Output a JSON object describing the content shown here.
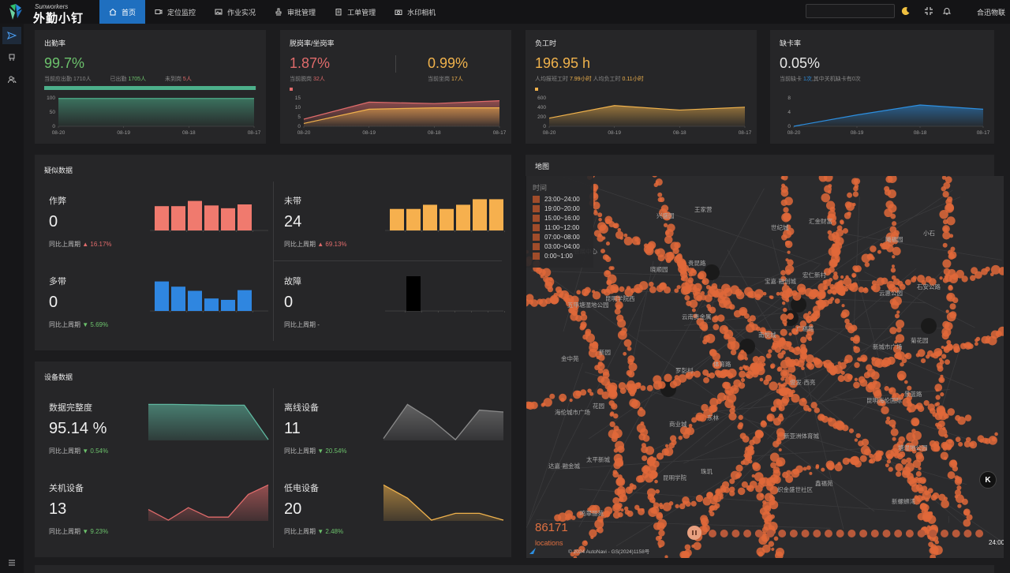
{
  "brand": {
    "sub": "Sunworkers",
    "name": "外勤小钉"
  },
  "nav": [
    {
      "label": "首页",
      "icon": "home-icon",
      "active": true
    },
    {
      "label": "定位监控",
      "icon": "video-icon",
      "active": false
    },
    {
      "label": "作业实况",
      "icon": "image-icon",
      "active": false
    },
    {
      "label": "审批管理",
      "icon": "stamp-icon",
      "active": false
    },
    {
      "label": "工单管理",
      "icon": "clipboard-icon",
      "active": false
    },
    {
      "label": "水印相机",
      "icon": "camera-icon",
      "active": false
    }
  ],
  "header": {
    "search_value": "",
    "org": "合迅物联"
  },
  "kpi": {
    "attendance": {
      "title": "出勤率",
      "value": "99.7%",
      "s1_label": "当前应出勤",
      "s1_value": "1710人",
      "s2_label": "已出勤",
      "s2_value": "1705人",
      "s3_label": "未到岗",
      "s3_value": "5人",
      "progress": 0.997
    },
    "offpost": {
      "title": "脱岗率/坐岗率",
      "value": "1.87%",
      "value2": "0.99%",
      "s1_label": "当前脱岗",
      "s1_value": "32人",
      "s2_label": "当前坐岗",
      "s2_value": "17人"
    },
    "workhours": {
      "title": "负工时",
      "value": "196.95 h",
      "s1_label": "人均报班工时",
      "s1_value": "7.99小时",
      "s2_label": "人均负工时",
      "s2_value": "0.11小时"
    },
    "cardmiss": {
      "title": "缺卡率",
      "value": "0.05%",
      "s1_label": "当前缺卡",
      "s1_value": "1次",
      "s2_label": ",其中关机缺卡有",
      "s2_value": "0次"
    }
  },
  "mini_charts": {
    "dates": [
      "08-20",
      "08-19",
      "08-18",
      "08-17"
    ],
    "attendance": {
      "ticks": [
        "100",
        "50",
        "0"
      ],
      "ymax": 100,
      "values": [
        98,
        98,
        98,
        98
      ],
      "color": "#4caf8a"
    },
    "offpost": {
      "ticks": [
        "15",
        "10",
        "5",
        "0"
      ],
      "ymax": 20,
      "series": [
        {
          "values": [
            5,
            17,
            16,
            18
          ],
          "color": "#e06b6b"
        },
        {
          "values": [
            2,
            12,
            13,
            13
          ],
          "color": "#f0b24c"
        }
      ]
    },
    "workhours": {
      "ticks": [
        "600",
        "400",
        "200",
        "0"
      ],
      "ymax": 700,
      "values": [
        200,
        510,
        400,
        470
      ],
      "color": "#f0b24c"
    },
    "cardmiss": {
      "ticks": [
        "8",
        "4",
        "0"
      ],
      "ymax": 10,
      "values": [
        0,
        4,
        7.5,
        6
      ],
      "color": "#2d8fe0"
    }
  },
  "suspect": {
    "title": "疑似数据",
    "cmp_label": "同比上周期",
    "cells": [
      {
        "label": "作弊",
        "value": "0",
        "trend": "up",
        "change": "16.17%",
        "color": "#f07a6e",
        "bars": [
          0.7,
          0.7,
          0.85,
          0.72,
          0.64,
          0.75
        ]
      },
      {
        "label": "未带",
        "value": "24",
        "trend": "up",
        "change": "69.13%",
        "color": "#f6b04e",
        "bars": [
          0.62,
          0.62,
          0.74,
          0.62,
          0.74,
          0.9,
          0.9
        ]
      },
      {
        "label": "多带",
        "value": "0",
        "trend": "down",
        "change": "5.69%",
        "color": "#2f86e0",
        "bars": [
          0.85,
          0.7,
          0.58,
          0.36,
          0.32,
          0.6
        ]
      },
      {
        "label": "故障",
        "value": "0",
        "trend": "none",
        "change": "-",
        "color": "#000000",
        "bars": [
          0,
          1.0,
          0,
          0,
          0,
          0,
          0
        ]
      }
    ]
  },
  "device": {
    "title": "设备数据",
    "cmp_label": "同比上周期",
    "cells": [
      {
        "label": "数据完整度",
        "value": "95.14 %",
        "trend": "down",
        "change": "0.54%",
        "color": "#5fb8a0",
        "line": [
          0.95,
          0.95,
          0.94,
          0.93,
          0.93,
          0.02
        ]
      },
      {
        "label": "离线设备",
        "value": "11",
        "trend": "down",
        "change": "20.54%",
        "color": "#8a8a8a",
        "line": [
          0.05,
          0.95,
          0.55,
          0.02,
          0.8,
          0.75
        ]
      },
      {
        "label": "关机设备",
        "value": "13",
        "trend": "down",
        "change": "9.23%",
        "color": "#e06b6b",
        "line": [
          0.3,
          0.02,
          0.35,
          0.1,
          0.1,
          0.7,
          0.95
        ]
      },
      {
        "label": "低电设备",
        "value": "20",
        "trend": "down",
        "change": "2.48%",
        "color": "#f0b24c",
        "line": [
          0.95,
          0.6,
          0.02,
          0.2,
          0.2,
          0.02
        ]
      }
    ]
  },
  "map": {
    "title": "地图",
    "legend_title": "时间",
    "legend": [
      {
        "label": "23:00~24:00",
        "color": "#a04c2a"
      },
      {
        "label": "19:00~20:00",
        "color": "#a04c2a"
      },
      {
        "label": "15:00~16:00",
        "color": "#a04c2a"
      },
      {
        "label": "11:00~12:00",
        "color": "#a04c2a"
      },
      {
        "label": "07:00~08:00",
        "color": "#a04c2a"
      },
      {
        "label": "03:00~04:00",
        "color": "#a04c2a"
      },
      {
        "label": "0:00~1:00",
        "color": "#a04c2a"
      }
    ],
    "count": "86171",
    "count_label": "locations",
    "attribution": "© 2024 AutoNavi - GS(2024)1158号",
    "time_end": "24:00",
    "hk": "K",
    "labels": [
      "中晋嘉鼎村",
      "晓顺园",
      "南悦城",
      "昆明海伦国际",
      "达嘉·融金城",
      "兴盛园",
      "宝嘉·融创城",
      "新城市广场",
      "海伦城市广场",
      "昆明学院",
      "世纪城",
      "云惠公园",
      "金中苑",
      "商业城",
      "织金盛世社区",
      "曦福园",
      "五甲塘湿地公园",
      "罗彭村",
      "新亚洲体育城",
      "新螺蛳湾",
      "会展中心",
      "云南贵金属",
      "俊发·西亮",
      "塘湿地公园",
      "鸣翠丽苑",
      "贵昆路",
      "广福路",
      "景蓝路",
      "太平新城",
      "王家营",
      "宏仁新村",
      "菊花园",
      "花园",
      "珠玑",
      "汇金财富",
      "石安公路",
      "新园",
      "东林",
      "鑫福苑",
      "小石",
      "昆明学院西",
      "体育路"
    ]
  }
}
